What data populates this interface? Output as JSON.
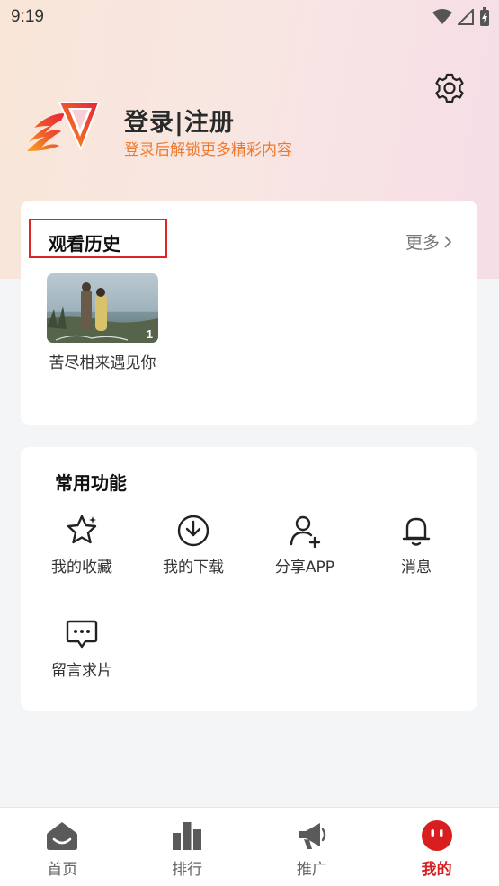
{
  "status_bar": {
    "time": "9:19"
  },
  "header": {
    "title": "登录|注册",
    "subtitle": "登录后解锁更多精彩内容"
  },
  "history": {
    "title": "观看历史",
    "more_label": "更多",
    "items": [
      {
        "title": "苦尽柑来遇见你",
        "episode": "1"
      }
    ]
  },
  "features": {
    "title": "常用功能",
    "items": [
      {
        "label": "我的收藏",
        "icon": "star-icon"
      },
      {
        "label": "我的下载",
        "icon": "download-icon"
      },
      {
        "label": "分享APP",
        "icon": "add-user-icon"
      },
      {
        "label": "消息",
        "icon": "bell-icon"
      },
      {
        "label": "留言求片",
        "icon": "chat-icon"
      }
    ]
  },
  "tabbar": {
    "items": [
      {
        "label": "首页",
        "icon": "home-icon",
        "active": false
      },
      {
        "label": "排行",
        "icon": "ranking-icon",
        "active": false
      },
      {
        "label": "推广",
        "icon": "megaphone-icon",
        "active": false
      },
      {
        "label": "我的",
        "icon": "profile-icon",
        "active": true
      }
    ]
  },
  "colors": {
    "accent_red": "#d81e1e",
    "subtitle_orange": "#ee7a2f",
    "highlight_border": "#e02424"
  }
}
